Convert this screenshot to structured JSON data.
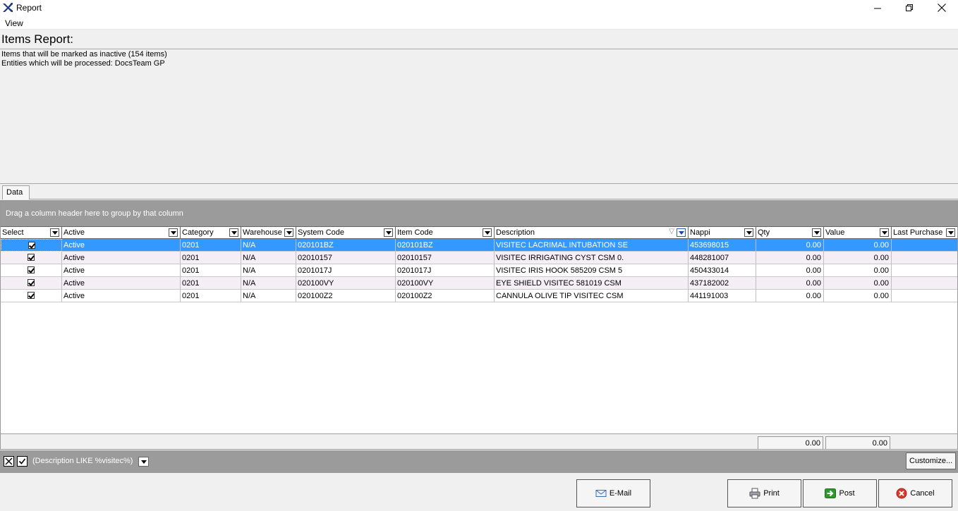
{
  "window": {
    "title": "Report"
  },
  "menu": {
    "view": "View"
  },
  "report": {
    "title": "Items Report:",
    "info1": "Items that will be marked as inactive (154 items)",
    "info2": "Entities which will be processed: DocsTeam GP"
  },
  "tabs": {
    "data": "Data"
  },
  "grid": {
    "group_hint": "Drag a column header here to group by that column",
    "columns": [
      "Select",
      "Active",
      "Category",
      "Warehouse",
      "System Code",
      "Item Code",
      "Description",
      "Nappi",
      "Qty",
      "Value",
      "Last Purchase"
    ],
    "rows": [
      {
        "active": "Active",
        "category": "0201",
        "warehouse": "N/A",
        "system_code": "020101BZ",
        "item_code": "020101BZ",
        "description": "VISITEC LACRIMAL INTUBATION SE",
        "nappi": "453698015",
        "qty": "0.00",
        "value": "0.00",
        "last_purchase": ""
      },
      {
        "active": "Active",
        "category": "0201",
        "warehouse": "N/A",
        "system_code": "02010157",
        "item_code": "02010157",
        "description": "VISITEC IRRIGATING CYST CSM 0.",
        "nappi": "448281007",
        "qty": "0.00",
        "value": "0.00",
        "last_purchase": ""
      },
      {
        "active": "Active",
        "category": "0201",
        "warehouse": "N/A",
        "system_code": "0201017J",
        "item_code": "0201017J",
        "description": "VISITEC IRIS HOOK 585209 CSM 5",
        "nappi": "450433014",
        "qty": "0.00",
        "value": "0.00",
        "last_purchase": ""
      },
      {
        "active": "Active",
        "category": "0201",
        "warehouse": "N/A",
        "system_code": "020100VY",
        "item_code": "020100VY",
        "description": "EYE SHIELD VISITEC 581019 CSM",
        "nappi": "437182002",
        "qty": "0.00",
        "value": "0.00",
        "last_purchase": ""
      },
      {
        "active": "Active",
        "category": "0201",
        "warehouse": "N/A",
        "system_code": "020100Z2",
        "item_code": "020100Z2",
        "description": "CANNULA OLIVE TIP VISITEC CSM",
        "nappi": "441191003",
        "qty": "0.00",
        "value": "0.00",
        "last_purchase": ""
      }
    ],
    "totals": {
      "qty": "0.00",
      "value": "0.00"
    }
  },
  "filter": {
    "expression": "(Description LIKE %visitec%)",
    "customize": "Customize..."
  },
  "buttons": {
    "email": "E-Mail",
    "print": "Print",
    "post": "Post",
    "cancel": "Cancel"
  },
  "colors": {
    "selection": "#3399ff",
    "alt_row": "#f5eef5",
    "panel_gray": "#9b9b9b"
  }
}
